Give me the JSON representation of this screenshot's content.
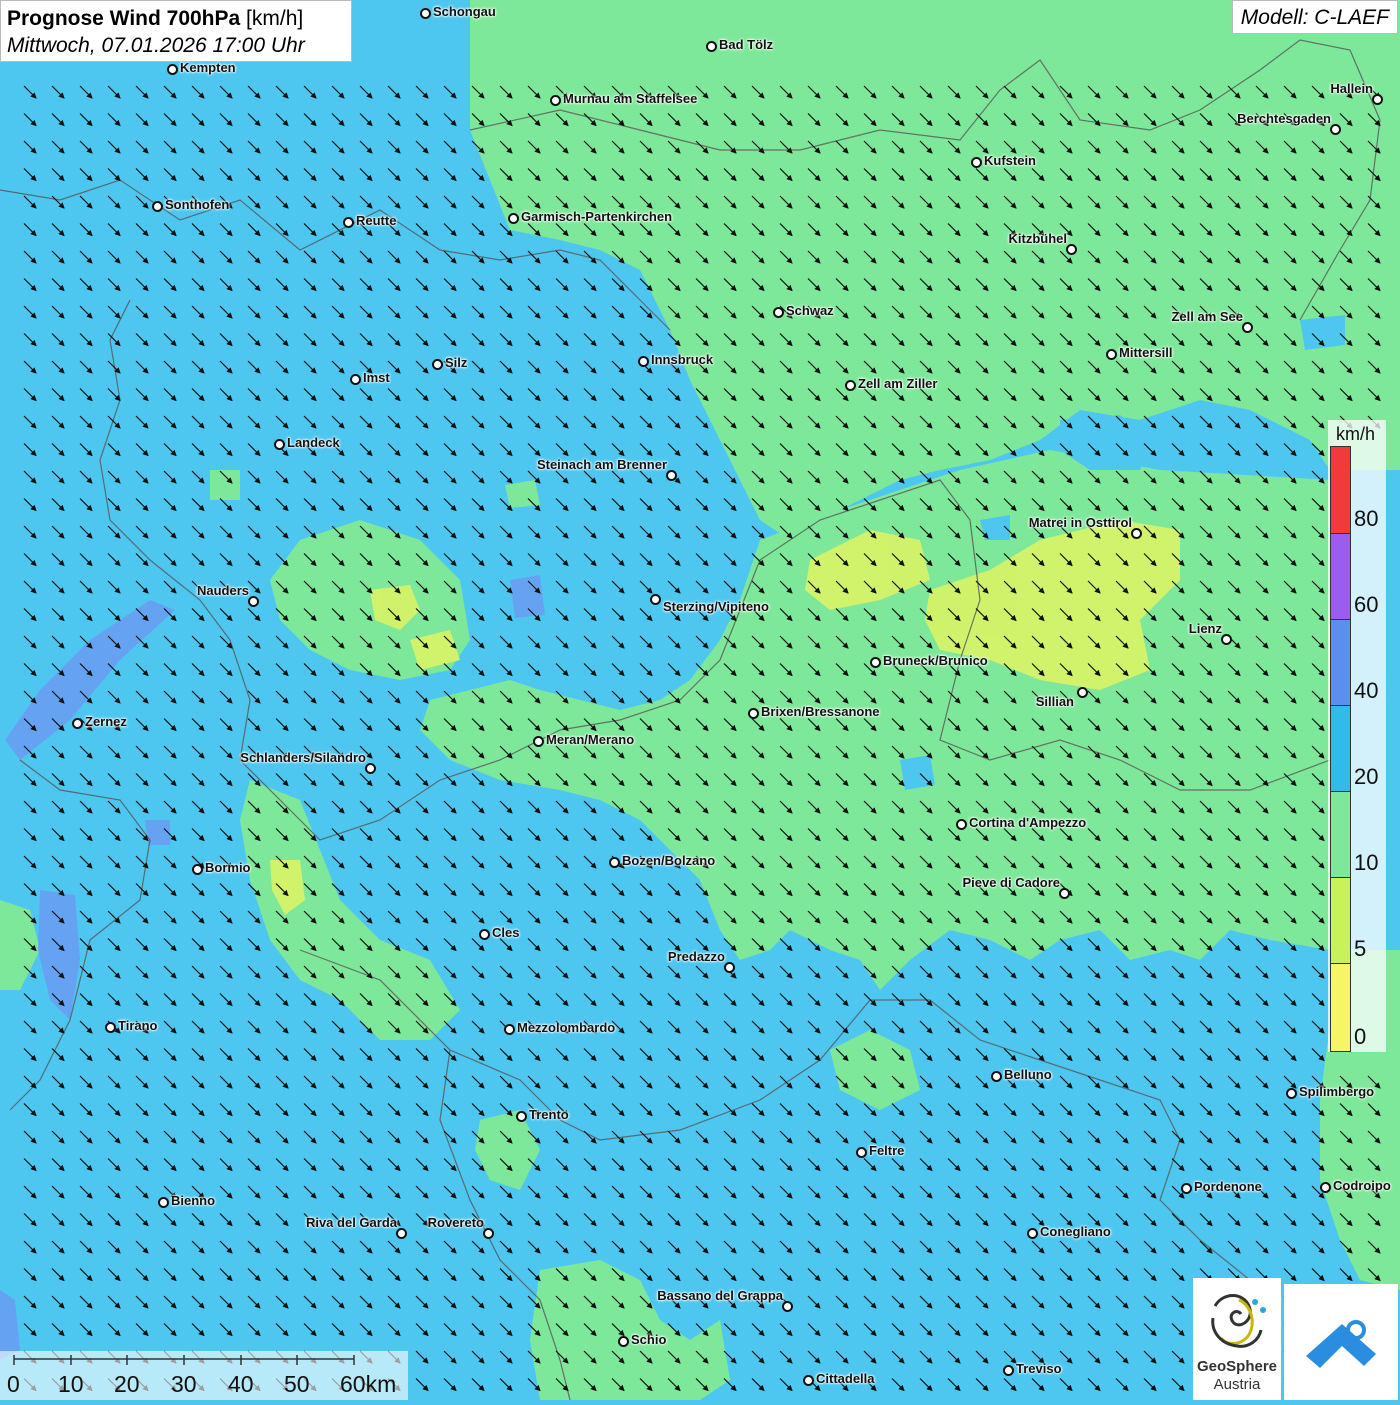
{
  "header": {
    "title_bold": "Prognose Wind 700hPa",
    "title_unit": "[km/h]",
    "datetime": "Mittwoch, 07.01.2026 17:00 Uhr",
    "model": "Modell: C-LAEF"
  },
  "legend": {
    "unit": "km/h",
    "labels": [
      "80",
      "60",
      "40",
      "20",
      "10",
      "5",
      "0"
    ],
    "colors": {
      "above_80": "#f23a3a",
      "60_80": "#9b5df0",
      "40_60": "#5a8ff0",
      "20_40": "#2fbcea",
      "10_20": "#7ee89a",
      "5_10": "#c7f25a",
      "0_5": "#f6f566"
    }
  },
  "scale": {
    "labels": [
      "0",
      "10",
      "20",
      "30",
      "40",
      "50",
      "60km"
    ]
  },
  "logos": {
    "geosphere_line1": "GeoSphere",
    "geosphere_line2": "Austria",
    "geosphere_icon": "geosphere-logo-icon",
    "app_icon": "cloud-arrow-logo-icon"
  },
  "map": {
    "wind_direction": "north-west to south-east",
    "cities": [
      "Schongau",
      "Bad Tölz",
      "Kempten",
      "Murnau am Staffelsee",
      "Hallein",
      "Berchtesgaden",
      "Kufstein",
      "Sonthofen",
      "Reutte",
      "Garmisch-Partenkirchen",
      "Kitzbühel",
      "Schwaz",
      "Zell am See",
      "Mittersill",
      "Silz",
      "Innsbruck",
      "Imst",
      "Zell am Ziller",
      "Landeck",
      "Steinach am Brenner",
      "Matrei in Osttirol",
      "Nauders",
      "Sterzing/Vipiteno",
      "Lienz",
      "Bruneck/Brunico",
      "Sillian",
      "Brixen/Bressanone",
      "Zernez",
      "Meran/Merano",
      "Schlanders/Silandro",
      "Cortina d'Ampezzo",
      "Bozen/Bolzano",
      "Bormio",
      "Pieve di Cadore",
      "Cles",
      "Predazzo",
      "Tirano",
      "Mezzolombardo",
      "Belluno",
      "Spilimbergo",
      "Trento",
      "Feltre",
      "Pordenone",
      "Codroipo",
      "Bienno",
      "Riva del Garda",
      "Rovereto",
      "Conegliano",
      "Bassano del Grappa",
      "Schio",
      "Treviso",
      "Cittadella"
    ]
  }
}
